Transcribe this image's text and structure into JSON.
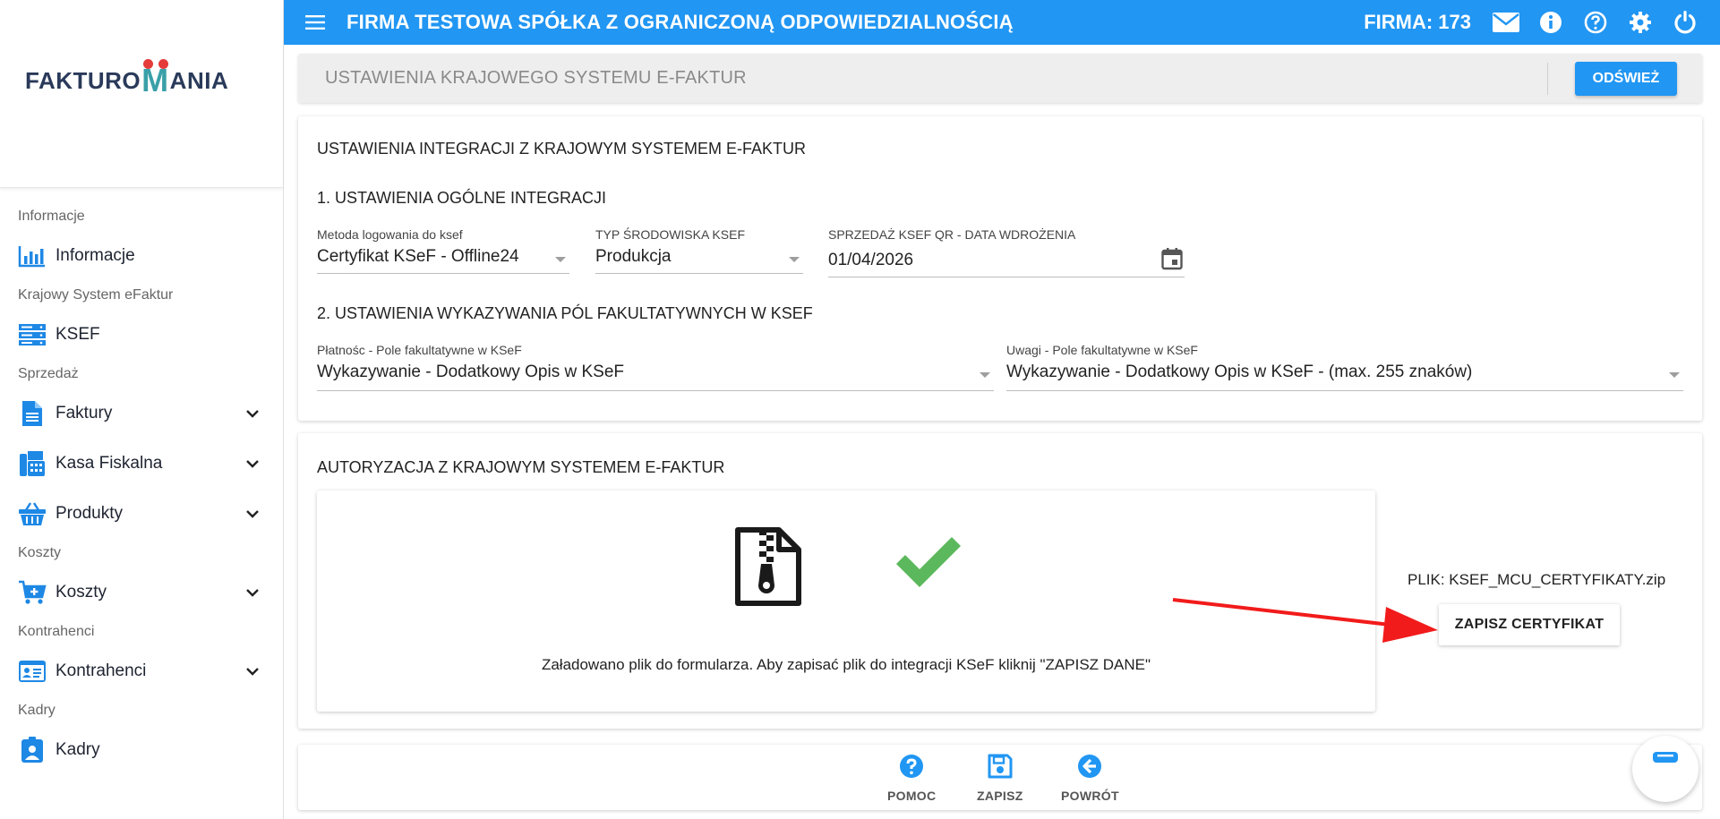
{
  "topbar": {
    "company_name": "FIRMA TESTOWA SPÓŁKA Z OGRANICZONĄ ODPOWIEDZIALNOŚCIĄ",
    "firma_label": "FIRMA: 173"
  },
  "logo": {
    "part1": "FAKTURO",
    "m": "M",
    "part2": "ANIA"
  },
  "sidebar": {
    "sections": [
      {
        "label": "Informacje",
        "items": [
          {
            "label": "Informacje",
            "icon": "bar-chart-icon",
            "expandable": false
          }
        ]
      },
      {
        "label": "Krajowy System eFaktur",
        "items": [
          {
            "label": "KSEF",
            "icon": "server-icon",
            "expandable": false
          }
        ]
      },
      {
        "label": "Sprzedaż",
        "items": [
          {
            "label": "Faktury",
            "icon": "document-icon",
            "expandable": true
          },
          {
            "label": "Kasa Fiskalna",
            "icon": "fax-icon",
            "expandable": true
          },
          {
            "label": "Produkty",
            "icon": "basket-icon",
            "expandable": true
          }
        ]
      },
      {
        "label": "Koszty",
        "items": [
          {
            "label": "Koszty",
            "icon": "cart-plus-icon",
            "expandable": true
          }
        ]
      },
      {
        "label": "Kontrahenci",
        "items": [
          {
            "label": "Kontrahenci",
            "icon": "id-card-icon",
            "expandable": true
          }
        ]
      },
      {
        "label": "Kadry",
        "items": [
          {
            "label": "Kadry",
            "icon": "user-badge-icon",
            "expandable": false
          }
        ]
      }
    ]
  },
  "header": {
    "title": "USTAWIENIA KRAJOWEGO SYSTEMU E-FAKTUR",
    "refresh_label": "ODŚWIEŻ"
  },
  "integration": {
    "title": "USTAWIENIA INTEGRACJI Z KRAJOWYM SYSTEMEM E-FAKTUR",
    "section1_title": "1. USTAWIENIA OGÓLNE INTEGRACJI",
    "login_method": {
      "label": "Metoda logowania do ksef",
      "value": "Certyfikat KSeF - Offline24"
    },
    "env_type": {
      "label": "TYP ŚRODOWISKA KSEF",
      "value": "Produkcja"
    },
    "qr_date": {
      "label": "SPRZEDAŻ KSEF QR - DATA WDROŻENIA",
      "value": "01/04/2026"
    },
    "section2_title": "2. USTAWIENIA WYKAZYWANIA PÓL FAKULTATYWNYCH W KSEF",
    "payment": {
      "label": "Płatnośc - Pole fakultatywne w KSeF",
      "value": "Wykazywanie - Dodatkowy Opis w KSeF"
    },
    "remarks": {
      "label": "Uwagi - Pole fakultatywne w KSeF",
      "value": "Wykazywanie - Dodatkowy Opis w KSeF - (max. 255 znaków)"
    }
  },
  "authorization": {
    "title": "AUTORYZACJA Z KRAJOWYM SYSTEMEM E-FAKTUR",
    "upload_message": "Załadowano plik do formularza. Aby zapisać plik do integracji KSeF kliknij \"ZAPISZ DANE\"",
    "file_label": "PLIK: KSEF_MCU_CERTYFIKATY.zip",
    "save_cert_label": "ZAPISZ CERTYFIKAT"
  },
  "actions": {
    "help_label": "POMOC",
    "save_label": "ZAPISZ",
    "back_label": "POWRÓT"
  },
  "colors": {
    "primary": "#2196f3",
    "success": "#5cb85c",
    "arrow": "#f21b1b",
    "sidebar_icon": "#1e88e5"
  }
}
